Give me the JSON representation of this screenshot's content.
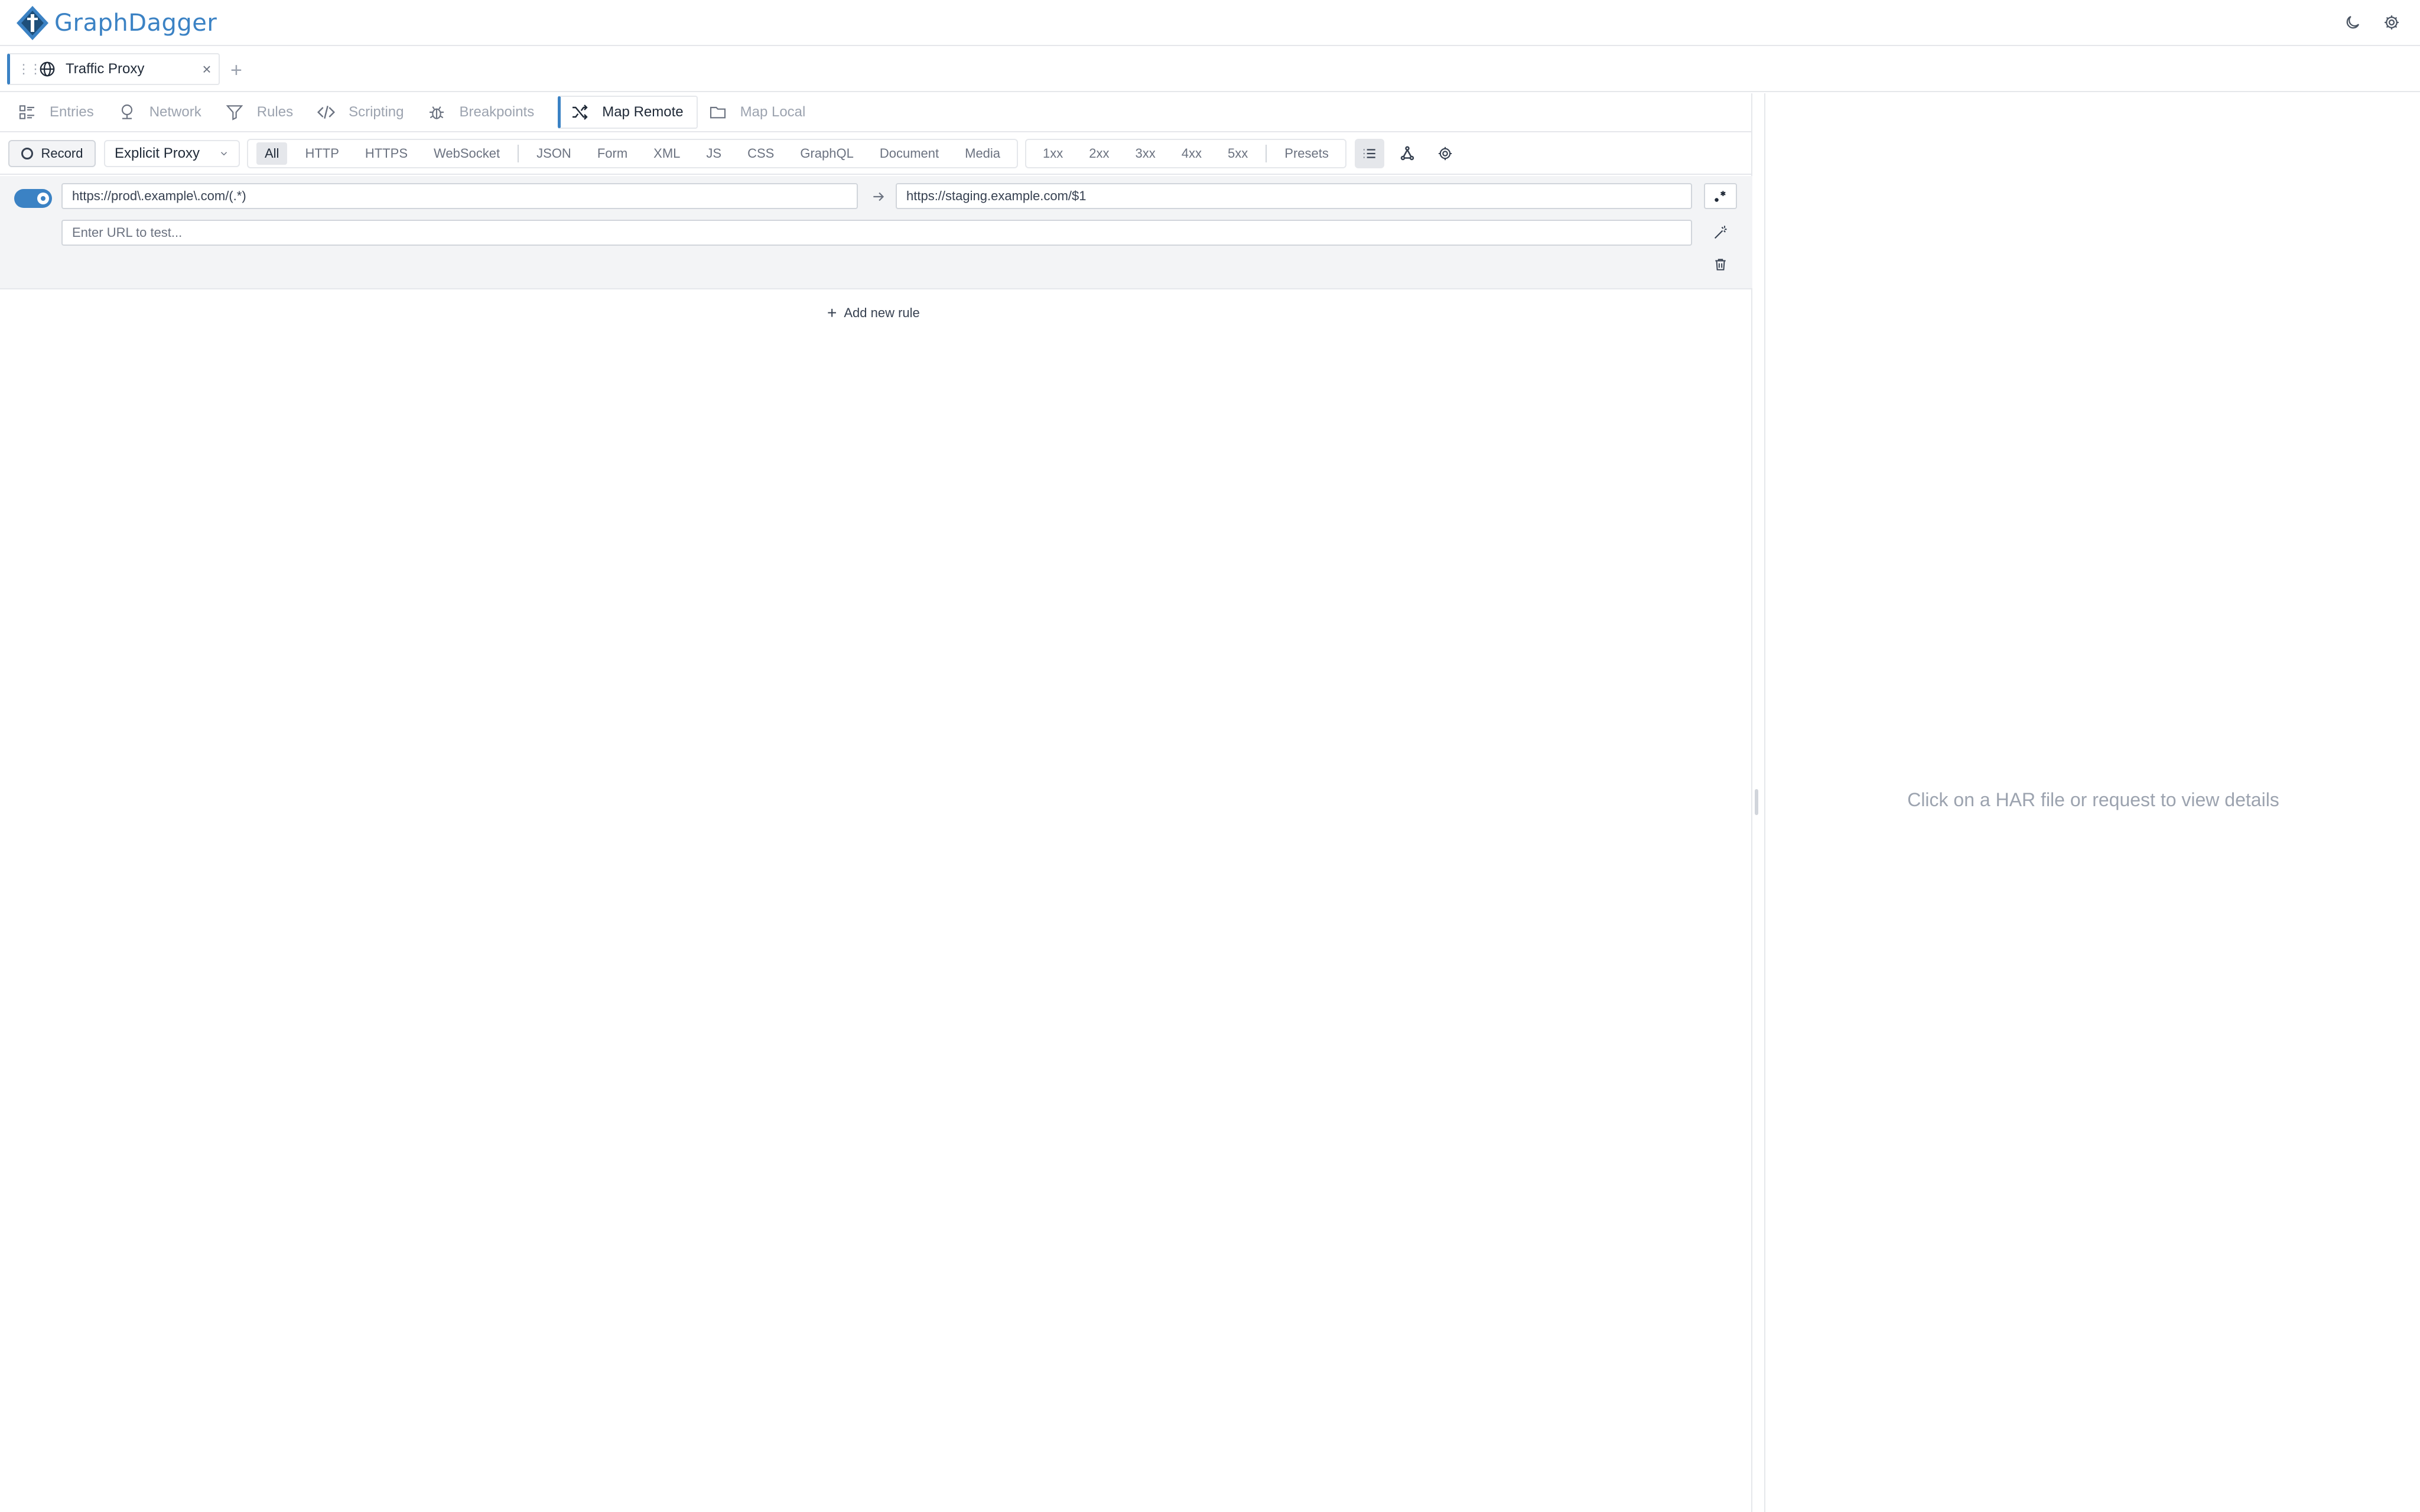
{
  "app": {
    "name": "GraphDagger"
  },
  "header_icons": [
    "moon-icon",
    "gear-icon"
  ],
  "session": {
    "title": "Traffic Proxy",
    "close": "×",
    "add": "+"
  },
  "nav_tabs": [
    {
      "label": "Entries",
      "icon": "list-icon",
      "active": false
    },
    {
      "label": "Network",
      "icon": "network-icon",
      "active": false
    },
    {
      "label": "Rules",
      "icon": "filter-icon",
      "active": false
    },
    {
      "label": "Scripting",
      "icon": "code-icon",
      "active": false
    },
    {
      "label": "Breakpoints",
      "icon": "bug-icon",
      "active": false
    },
    {
      "label": "Map Remote",
      "icon": "shuffle-icon",
      "active": true
    },
    {
      "label": "Map Local",
      "icon": "folder-icon",
      "active": false
    }
  ],
  "toolbar": {
    "record_label": "Record",
    "proxy_mode": "Explicit Proxy",
    "type_filters": [
      "All",
      "HTTP",
      "HTTPS",
      "WebSocket"
    ],
    "content_filters": [
      "JSON",
      "Form",
      "XML",
      "JS",
      "CSS",
      "GraphQL",
      "Document",
      "Media"
    ],
    "status_filters": [
      "1xx",
      "2xx",
      "3xx",
      "4xx",
      "5xx"
    ],
    "presets_label": "Presets",
    "active_filter": "All"
  },
  "rule": {
    "enabled": true,
    "source": "https://prod\\.example\\.com/(.*)",
    "target": "https://staging.example.com/$1",
    "test_placeholder": "Enter URL to test..."
  },
  "add_rule_label": "Add new rule",
  "details": {
    "empty_message": "Click on a HAR file or request to view details"
  },
  "colors": {
    "accent": "#3b82c4",
    "border": "#e5e7eb",
    "muted_text": "#9ca3af"
  }
}
